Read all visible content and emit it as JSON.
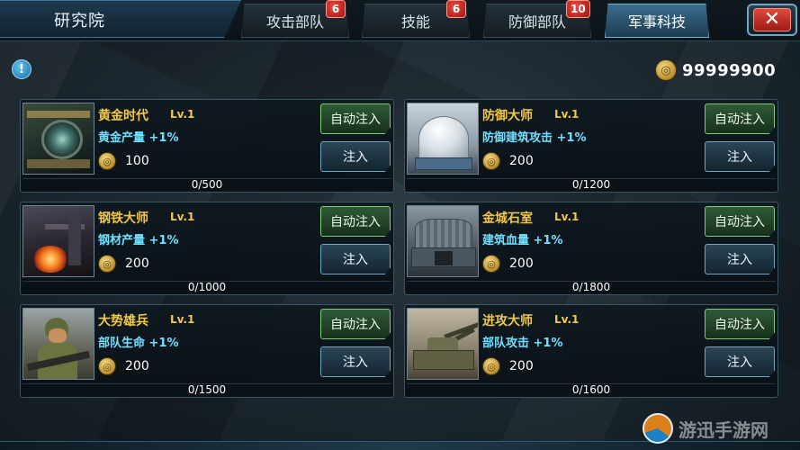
{
  "header": {
    "title": "研究院",
    "tabs": [
      {
        "label": "攻击部队",
        "badge": "6",
        "active": false
      },
      {
        "label": "技能",
        "badge": "6",
        "active": false
      },
      {
        "label": "防御部队",
        "badge": "10",
        "active": false
      },
      {
        "label": "军事科技",
        "badge": "",
        "active": true
      }
    ],
    "close_icon": "close-icon"
  },
  "info_icon": "info-icon",
  "gold_total": "99999900",
  "buttons": {
    "auto_inject": "自动注入",
    "inject": "注入"
  },
  "techs": [
    {
      "name": "黄金时代",
      "level": "Lv.1",
      "effect": "黄金产量 +1%",
      "cost": "100",
      "progress": "0/500",
      "progress_fraction": 0,
      "art": "gold"
    },
    {
      "name": "防御大师",
      "level": "Lv.1",
      "effect": "防御建筑攻击 +1%",
      "cost": "200",
      "progress": "0/1200",
      "progress_fraction": 0,
      "art": "dome"
    },
    {
      "name": "钢铁大师",
      "level": "Lv.1",
      "effect": "钢材产量 +1%",
      "cost": "200",
      "progress": "0/1000",
      "progress_fraction": 0,
      "art": "steel"
    },
    {
      "name": "金城石室",
      "level": "Lv.1",
      "effect": "建筑血量 +1%",
      "cost": "200",
      "progress": "0/1800",
      "progress_fraction": 0,
      "art": "bunker"
    },
    {
      "name": "大势雄兵",
      "level": "Lv.1",
      "effect": "部队生命 +1%",
      "cost": "200",
      "progress": "0/1500",
      "progress_fraction": 0,
      "art": "soldier"
    },
    {
      "name": "进攻大师",
      "level": "Lv.1",
      "effect": "部队攻击 +1%",
      "cost": "200",
      "progress": "0/1600",
      "progress_fraction": 0,
      "art": "tank"
    }
  ],
  "watermark": "游迅手游网",
  "colors": {
    "name": "#f2c84a",
    "effect": "#6fe0ff",
    "accent": "#6fb6dc",
    "badge": "#c2241b"
  }
}
